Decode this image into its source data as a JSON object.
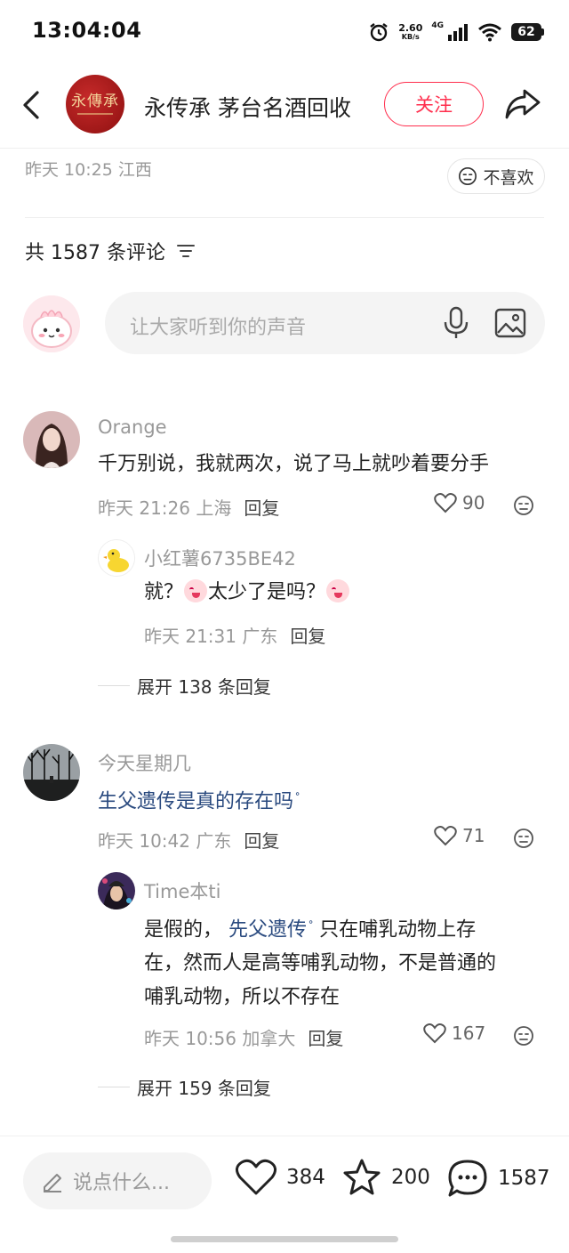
{
  "status_bar": {
    "time": "13:04:04",
    "speed_value": "2.60",
    "speed_unit": "KB/s",
    "network": "4G",
    "battery": "62"
  },
  "header": {
    "logo_text": "永傳承",
    "account_name": "永传承 茅台名酒回收",
    "follow_label": "关注"
  },
  "post_meta": {
    "time_location": "昨天 10:25 江西",
    "dislike_label": "不喜欢"
  },
  "comments_header": {
    "count_label": "共 1587 条评论"
  },
  "comment_input": {
    "placeholder": "让大家听到你的声音"
  },
  "comments": [
    {
      "username": "Orange",
      "text": "千万别说，我就两次，说了马上就吵着要分手",
      "time_location": "昨天 21:26 上海",
      "reply_label": "回复",
      "likes": "90",
      "reply": {
        "username": "小红薯6735BE42",
        "text_a": "就？",
        "text_b": "太少了是吗？",
        "time_location": "昨天 21:31 广东",
        "reply_label": "回复"
      },
      "expand_label": "展开 138 条回复"
    },
    {
      "username": "今天星期几",
      "link_text": "生父遗传是真的存在吗",
      "time_location": "昨天 10:42 广东",
      "reply_label": "回复",
      "likes": "71",
      "reply": {
        "username": "Time本ti",
        "text_prefix": "是假的，",
        "link_text": "先父遗传",
        "line1_rest": "只在哺乳动物上存",
        "line2": "在，然而人是高等哺乳动物，不是普通的",
        "line3": "哺乳动物，所以不存在",
        "time_location": "昨天 10:56 加拿大",
        "reply_label": "回复",
        "likes": "167"
      },
      "expand_label": "展开 159 条回复"
    }
  ],
  "bottom_bar": {
    "say_placeholder": "说点什么...",
    "like_count": "384",
    "star_count": "200",
    "comment_count": "1587"
  },
  "colors": {
    "accent": "#ff2e4d",
    "link": "#2a4a7f",
    "muted_text": "#999999"
  }
}
